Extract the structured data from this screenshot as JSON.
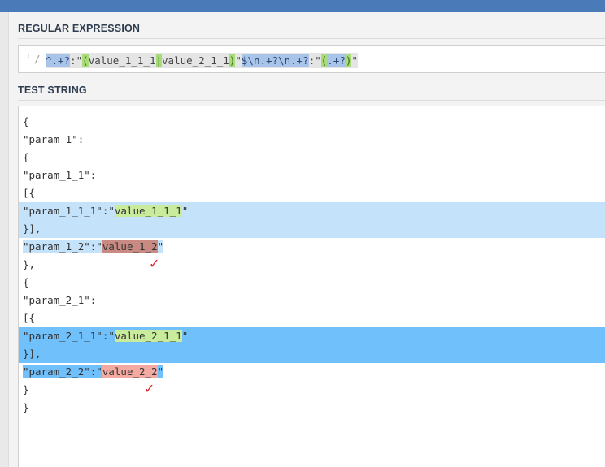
{
  "regex_section": {
    "label": "REGULAR EXPRESSION",
    "delimiter": "/",
    "tokens": [
      {
        "text": "^.+?",
        "kind": "blue"
      },
      {
        "text": ":\"",
        "kind": "plain"
      },
      {
        "text": "(",
        "kind": "green"
      },
      {
        "text": "value_1_1_1",
        "kind": "plain"
      },
      {
        "text": "|",
        "kind": "green"
      },
      {
        "text": "value_2_1_1",
        "kind": "plain"
      },
      {
        "text": ")",
        "kind": "green"
      },
      {
        "text": "\"",
        "kind": "plain"
      },
      {
        "text": "$\\n.+?\\n.+?",
        "kind": "blue"
      },
      {
        "text": ":\"",
        "kind": "plain"
      },
      {
        "text": "(",
        "kind": "green"
      },
      {
        "text": ".+?",
        "kind": "blue"
      },
      {
        "text": ")",
        "kind": "green"
      },
      {
        "text": "\"",
        "kind": "plain"
      }
    ]
  },
  "test_section": {
    "label": "TEST STRING",
    "lines": [
      {
        "parts": [
          {
            "t": "{",
            "c": ""
          }
        ]
      },
      {
        "parts": [
          {
            "t": "\"param_1\":",
            "c": ""
          }
        ]
      },
      {
        "parts": [
          {
            "t": "{",
            "c": ""
          }
        ]
      },
      {
        "parts": [
          {
            "t": "\"param_1_1\":",
            "c": ""
          }
        ]
      },
      {
        "parts": [
          {
            "t": "[{",
            "c": ""
          }
        ]
      },
      {
        "full": "light",
        "parts": [
          {
            "t": "\"param_1_1_1\":\"",
            "c": ""
          },
          {
            "t": "value_1_1_1",
            "c": "green"
          },
          {
            "t": "\"",
            "c": ""
          }
        ]
      },
      {
        "full": "light",
        "parts": [
          {
            "t": "}],",
            "c": ""
          }
        ]
      },
      {
        "parts": [
          {
            "t": "\"param_1_2\":\"",
            "c": "light"
          },
          {
            "t": "value_1_2",
            "c": "reddark"
          },
          {
            "t": "\"",
            "c": "light"
          }
        ]
      },
      {
        "parts": [
          {
            "t": "},",
            "c": ""
          }
        ]
      },
      {
        "parts": [
          {
            "t": "{",
            "c": ""
          }
        ]
      },
      {
        "parts": [
          {
            "t": "\"param_2_1\":",
            "c": ""
          }
        ]
      },
      {
        "parts": [
          {
            "t": "[{",
            "c": ""
          }
        ]
      },
      {
        "full": "mid",
        "parts": [
          {
            "t": "\"param_2_1_1\":\"",
            "c": ""
          },
          {
            "t": "value_2_1_1",
            "c": "green"
          },
          {
            "t": "\"",
            "c": ""
          }
        ]
      },
      {
        "full": "mid",
        "parts": [
          {
            "t": "}],",
            "c": ""
          }
        ]
      },
      {
        "parts": [
          {
            "t": "\"param_2_2\":\"",
            "c": "mid"
          },
          {
            "t": "value_2_2",
            "c": "red"
          },
          {
            "t": "\"",
            "c": "mid"
          }
        ]
      },
      {
        "parts": [
          {
            "t": "}",
            "c": ""
          }
        ]
      },
      {
        "parts": [
          {
            "t": "}",
            "c": ""
          }
        ]
      }
    ],
    "annotations": [
      {
        "text": "✓",
        "name": "checkmark-1"
      },
      {
        "text": "✓",
        "name": "checkmark-2"
      }
    ]
  }
}
